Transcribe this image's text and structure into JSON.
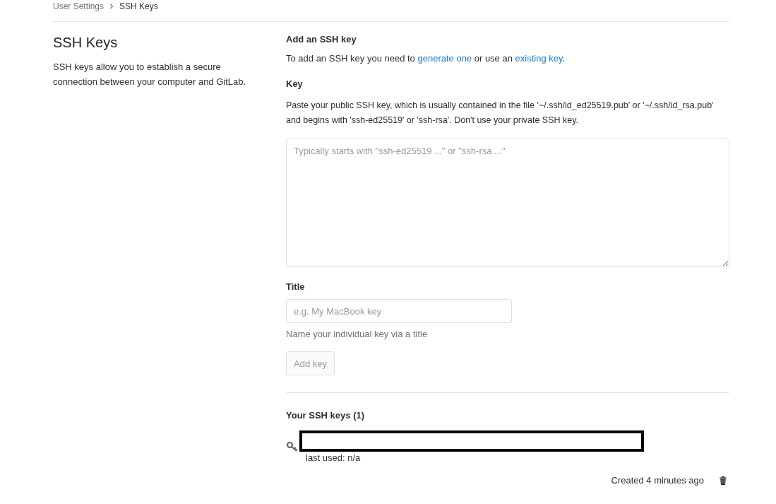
{
  "breadcrumb": [
    {
      "label": "User Settings",
      "selected": false
    },
    {
      "label": "SSH Keys",
      "selected": true
    }
  ],
  "sidebar": {
    "title": "SSH Keys",
    "description": "SSH keys allow you to establish a secure connection between your computer and GitLab."
  },
  "add_key": {
    "heading": "Add an SSH key",
    "intro": [
      {
        "kind": "text",
        "text": "To add an SSH key you need to "
      },
      {
        "kind": "link",
        "text": "generate one"
      },
      {
        "kind": "text",
        "text": " or use an "
      },
      {
        "kind": "link",
        "text": "existing key"
      },
      {
        "kind": "text",
        "text": "."
      }
    ],
    "key_label": "Key",
    "key_help": "Paste your public SSH key, which is usually contained in the file '~/.ssh/id_ed25519.pub' or '~/.ssh/id_rsa.pub' and begins with 'ssh-ed25519' or 'ssh-rsa'. Don't use your private SSH key.",
    "key_field": {
      "placeholder": "Typically starts with \"ssh-ed25519 ...\" or \"ssh-rsa ...\""
    },
    "title_label": "Title",
    "title_field": {
      "placeholder": "e.g. My MacBook key"
    },
    "title_help": "Name your individual key via a title",
    "submit": {
      "label": "Add key",
      "disabled": true
    }
  },
  "keys": {
    "heading": "Your SSH keys (1)",
    "items": [
      {
        "last_used": "last used: n/a",
        "created": "Created 4 minutes ago"
      }
    ]
  }
}
